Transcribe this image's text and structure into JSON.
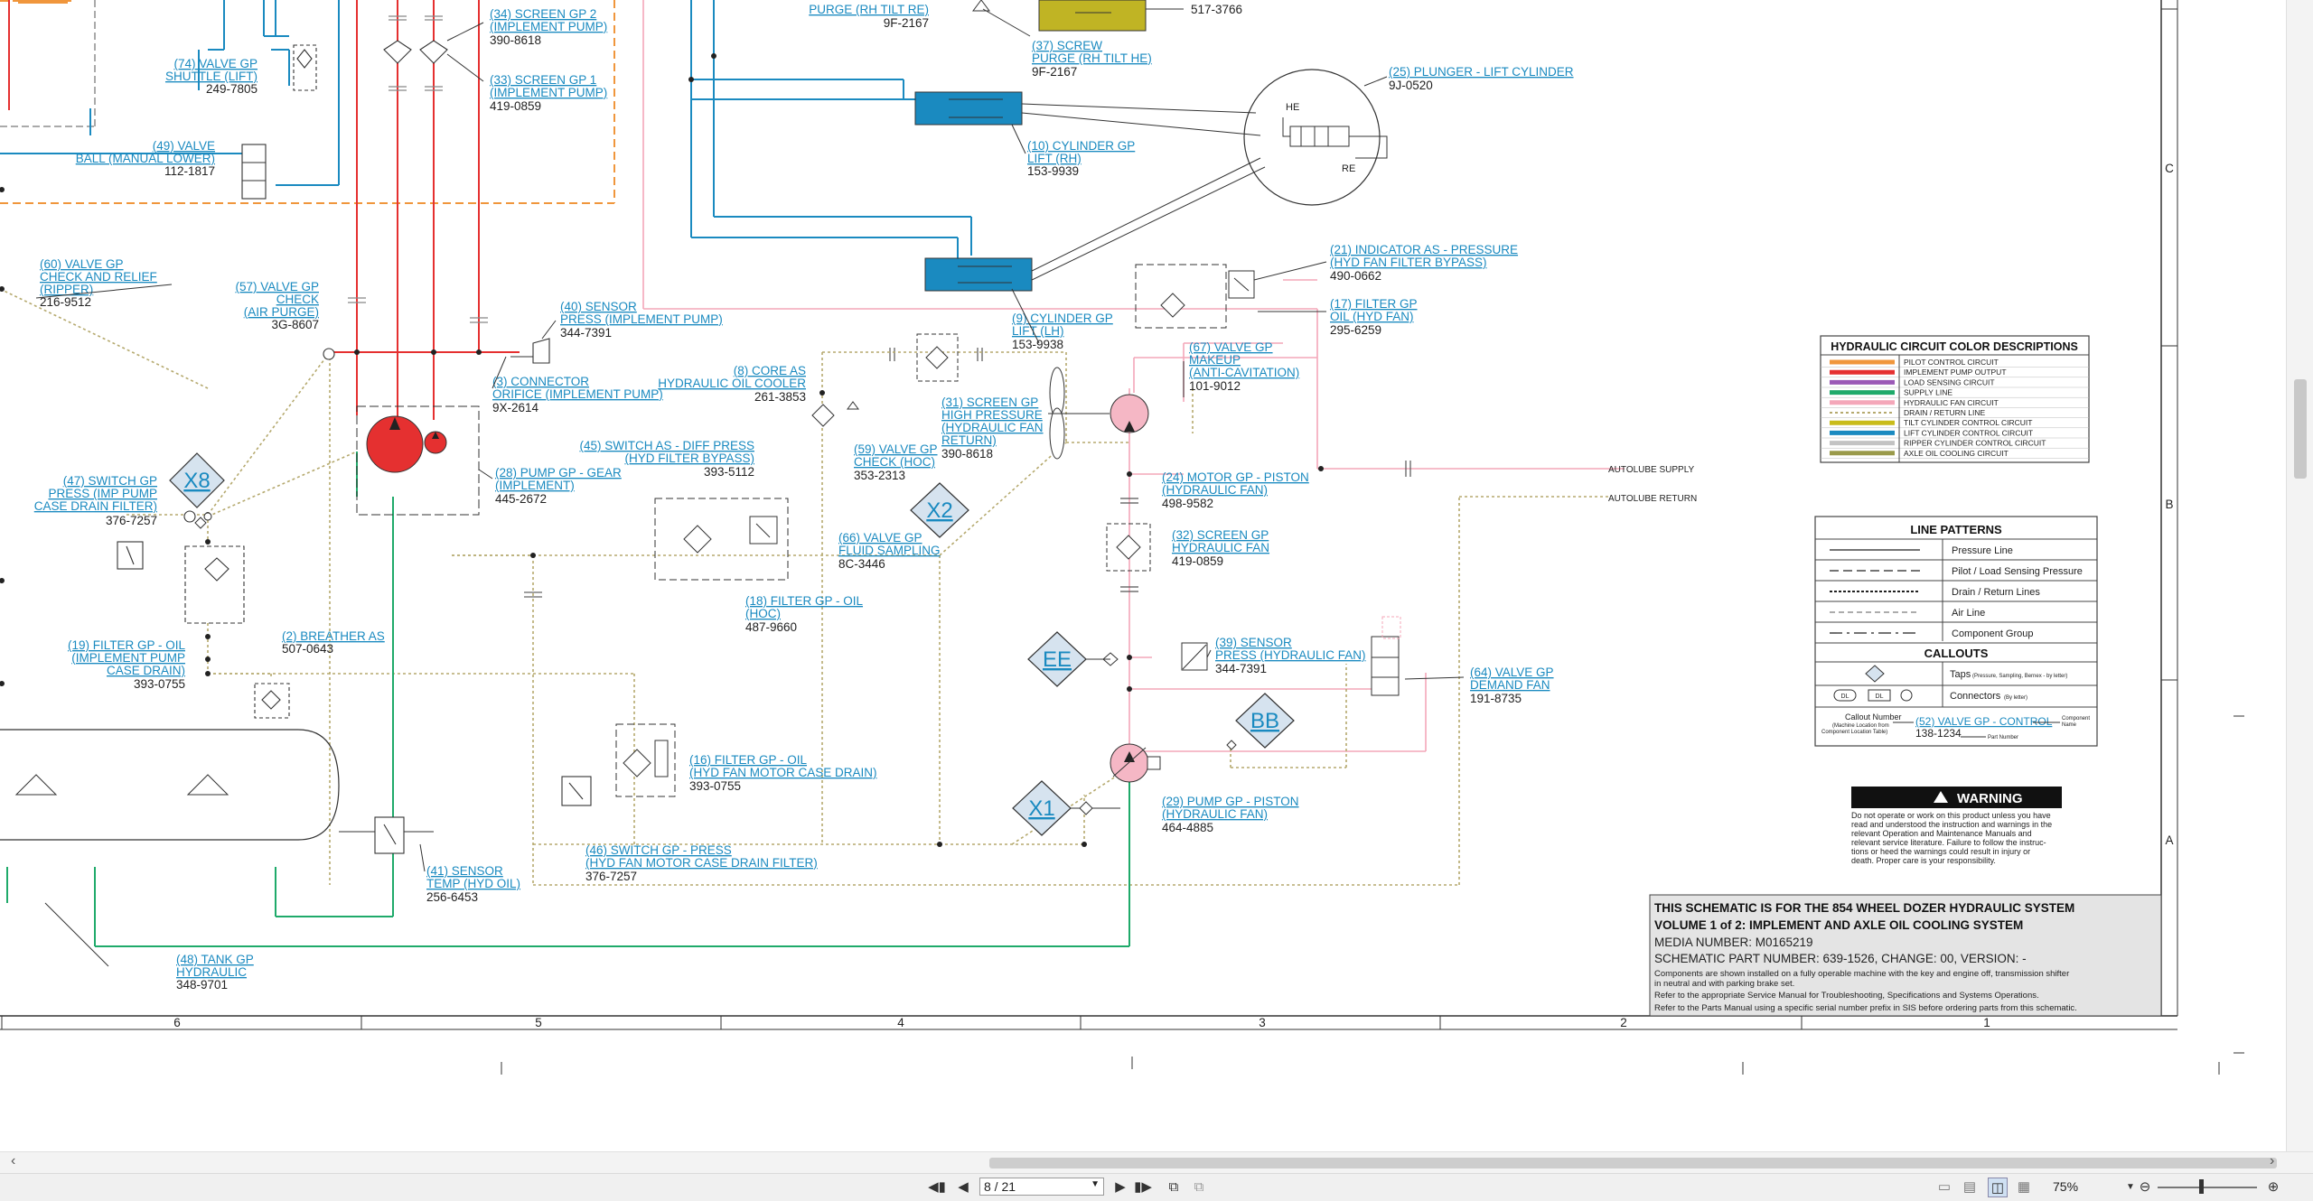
{
  "labels": {
    "l74": [
      "(74) VALVE GP",
      "SHUTTLE (LIFT)"
    ],
    "p74": "249-7805",
    "l49": [
      "(49) VALVE",
      "BALL (MANUAL LOWER)"
    ],
    "p49": "112-1817",
    "l60": [
      "(60) VALVE GP",
      "CHECK AND RELIEF",
      "(RIPPER)"
    ],
    "p60": "216-9512",
    "l57": [
      "(57) VALVE GP",
      "CHECK",
      "(AIR PURGE)"
    ],
    "p57": "3G-8607",
    "l47": [
      "(47) SWITCH GP",
      "PRESS (IMP PUMP",
      "CASE DRAIN FILTER)"
    ],
    "p47": "376-7257",
    "l19": [
      "(19) FILTER GP - OIL",
      "(IMPLEMENT PUMP",
      "CASE DRAIN)"
    ],
    "p19": "393-0755",
    "l2": [
      "(2) BREATHER AS"
    ],
    "p2": "507-0643",
    "l48": [
      "(48) TANK GP",
      "HYDRAULIC"
    ],
    "p48": "348-9701",
    "l34": [
      "(34) SCREEN GP 2",
      "(IMPLEMENT PUMP)"
    ],
    "p34": "390-8618",
    "l33": [
      "(33) SCREEN GP 1",
      "(IMPLEMENT PUMP)"
    ],
    "p33": "419-0859",
    "l40": [
      "(40) SENSOR",
      "PRESS (IMPLEMENT PUMP)"
    ],
    "p40": "344-7391",
    "l3": [
      "(3) CONNECTOR",
      "ORIFICE (IMPLEMENT PUMP)"
    ],
    "p3": "9X-2614",
    "l28": [
      "(28) PUMP GP - GEAR",
      "(IMPLEMENT)"
    ],
    "p28": "445-2672",
    "l41": [
      "(41) SENSOR",
      "TEMP (HYD OIL)"
    ],
    "p41": "256-6453",
    "lpurge": [
      "PURGE (RH TILT RE)"
    ],
    "ppurge": "9F-2167",
    "l37": [
      "(37) SCREW",
      "PURGE (RH TILT HE)"
    ],
    "p37": "9F-2167",
    "p517": "517-3766",
    "l25": [
      "(25) PLUNGER - LIFT CYLINDER"
    ],
    "p25": "9J-0520",
    "l10": [
      "(10) CYLINDER GP",
      "LIFT (RH)"
    ],
    "p10": "153-9939",
    "l9": [
      "(9) CYLINDER GP",
      "LIFT (LH)"
    ],
    "p9": "153-9938",
    "l21": [
      "(21) INDICATOR AS - PRESSURE",
      "(HYD FAN FILTER BYPASS)"
    ],
    "p21": "490-0662",
    "l17": [
      "(17) FILTER GP",
      "OIL (HYD FAN)"
    ],
    "p17": "295-6259",
    "l8": [
      "(8) CORE AS",
      "HYDRAULIC OIL COOLER"
    ],
    "p8": "261-3853",
    "l31": [
      "(31) SCREEN GP",
      "HIGH PRESSURE",
      "(HYDRAULIC FAN",
      "RETURN)"
    ],
    "p31": "390-8618",
    "l67": [
      "(67) VALVE GP",
      "MAKEUP",
      "(ANTI-CAVITATION)"
    ],
    "p67": "101-9012",
    "l45": [
      "(45) SWITCH AS - DIFF PRESS",
      "(HYD FILTER BYPASS)"
    ],
    "p45": "393-5112",
    "l59": [
      "(59) VALVE GP",
      "CHECK (HOC)"
    ],
    "p59": "353-2313",
    "l66": [
      "(66) VALVE GP",
      "FLUID SAMPLING"
    ],
    "p66": "8C-3446",
    "l18": [
      "(18) FILTER GP - OIL",
      "(HOC)"
    ],
    "p18": "487-9660",
    "l24": [
      "(24) MOTOR GP - PISTON",
      "(HYDRAULIC FAN)"
    ],
    "p24": "498-9582",
    "l32": [
      "(32) SCREEN GP",
      "HYDRAULIC FAN"
    ],
    "p32": "419-0859",
    "l39": [
      "(39) SENSOR",
      "PRESS (HYDRAULIC FAN)"
    ],
    "p39": "344-7391",
    "l16": [
      "(16) FILTER GP - OIL",
      "(HYD FAN MOTOR CASE DRAIN)"
    ],
    "p16": "393-0755",
    "l46": [
      "(46) SWITCH GP - PRESS",
      "(HYD FAN MOTOR CASE DRAIN FILTER)"
    ],
    "p46": "376-7257",
    "l29": [
      "(29) PUMP GP - PISTON",
      "(HYDRAULIC FAN)"
    ],
    "p29": "464-4885",
    "l64": [
      "(64) VALVE GP",
      "DEMAND FAN"
    ],
    "p64": "191-8735",
    "he": "HE",
    "re": "RE",
    "autolube_supply": "AUTOLUBE SUPPLY",
    "autolube_return": "AUTOLUBE RETURN"
  },
  "callouts": {
    "x8": "X8",
    "x2": "X2",
    "ee": "EE",
    "bb": "BB",
    "x1": "X1"
  },
  "zones_right": [
    "C",
    "B",
    "A"
  ],
  "columns_bottom": [
    "6",
    "5",
    "4",
    "3",
    "2",
    "1"
  ],
  "color_legend": {
    "title": "HYDRAULIC CIRCUIT COLOR DESCRIPTIONS",
    "items": [
      {
        "color": "#f0963c",
        "label": "PILOT CONTROL CIRCUIT",
        "dotted": false
      },
      {
        "color": "#e53030",
        "label": "IMPLEMENT PUMP OUTPUT",
        "dotted": false
      },
      {
        "color": "#9b59b6",
        "label": "LOAD SENSING CIRCUIT",
        "dotted": false
      },
      {
        "color": "#1faa6a",
        "label": "SUPPLY LINE",
        "dotted": false
      },
      {
        "color": "#f4a7b9",
        "label": "HYDRAULIC FAN CIRCUIT",
        "dotted": false
      },
      {
        "color": "#b5a96e",
        "label": "DRAIN / RETURN LINE",
        "dotted": true
      },
      {
        "color": "#c9bc1a",
        "label": "TILT CYLINDER CONTROL CIRCUIT",
        "dotted": false
      },
      {
        "color": "#1a8ac0",
        "label": "LIFT CYLINDER CONTROL CIRCUIT",
        "dotted": false
      },
      {
        "color": "#c3c3c3",
        "label": "RIPPER CYLINDER CONTROL CIRCUIT",
        "dotted": false
      },
      {
        "color": "#9a9a4a",
        "label": "AXLE OIL COOLING CIRCUIT",
        "dotted": false
      }
    ]
  },
  "line_patterns": {
    "title": "LINE PATTERNS",
    "items": [
      "Pressure Line",
      "Pilot / Load Sensing Pressure",
      "Drain / Return Lines",
      "Air Line",
      "Component Group"
    ],
    "callouts_title": "CALLOUTS",
    "taps": "Taps",
    "taps_note": "(Pressure, Sampling, Bernex - by letter)",
    "connectors": "Connectors",
    "connectors_note": "(By letter)",
    "conn_symbols": [
      "DL",
      "DL"
    ],
    "callout_number": "Callout Number",
    "callout_number_note": [
      "(Machine Location from",
      "Component Location Table)"
    ],
    "example_label": "(52) VALVE GP - CONTROL",
    "example_part": "138-1234",
    "part_number": "Part Number",
    "component_name": [
      "Component",
      "Name"
    ]
  },
  "warning": {
    "title": "WARNING",
    "lines": [
      "Do not operate or work on this product unless you have",
      "read and understood the instruction and warnings in the",
      "relevant Operation and Maintenance Manuals and",
      "relevant service literature. Failure to follow the instruc-",
      "tions or heed the warnings could result in injury or",
      "death. Proper care is your responsibility."
    ]
  },
  "title_block": {
    "line1": "THIS SCHEMATIC IS FOR THE 854 WHEEL DOZER HYDRAULIC SYSTEM",
    "line2": "VOLUME 1 of 2: IMPLEMENT AND AXLE OIL COOLING SYSTEM",
    "line3": "MEDIA NUMBER: M0165219",
    "line4": "SCHEMATIC PART NUMBER: 639-1526, CHANGE: 00, VERSION: -",
    "notes": [
      "Components are shown installed on a fully operable machine with the key and engine off, transmission shifter",
      "in neutral and with parking brake set.",
      "Refer to the appropriate Service Manual for Troubleshooting, Specifications and Systems Operations.",
      "Refer to the Parts Manual using a specific serial number prefix in SIS before ordering parts from this schematic."
    ]
  },
  "toolbar": {
    "page_current": "8 / 21",
    "zoom": "75%"
  },
  "colors": {
    "lift": "#1a8ac0",
    "tilt": "#c9bc1a",
    "implement": "#e53030",
    "pilot": "#f0963c",
    "fan": "#f4a7b9",
    "supply": "#1faa6a",
    "drain": "#b5a96e",
    "fan_pump": "#f5b7c5",
    "hyd_pump": "#e53030"
  }
}
